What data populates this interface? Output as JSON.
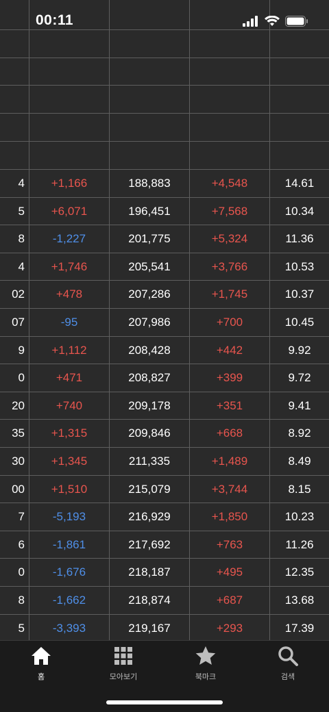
{
  "status_bar": {
    "time": "00:11"
  },
  "table": {
    "rows": [
      {
        "c0": "4",
        "c1": "+1,166",
        "c2": "188,883",
        "c3": "+4,548",
        "c4": "14.61",
        "s1": "pos",
        "s3": "pos"
      },
      {
        "c0": "5",
        "c1": "+6,071",
        "c2": "196,451",
        "c3": "+7,568",
        "c4": "10.34",
        "s1": "pos",
        "s3": "pos"
      },
      {
        "c0": "8",
        "c1": "-1,227",
        "c2": "201,775",
        "c3": "+5,324",
        "c4": "11.36",
        "s1": "neg",
        "s3": "pos"
      },
      {
        "c0": "4",
        "c1": "+1,746",
        "c2": "205,541",
        "c3": "+3,766",
        "c4": "10.53",
        "s1": "pos",
        "s3": "pos"
      },
      {
        "c0": "02",
        "c1": "+478",
        "c2": "207,286",
        "c3": "+1,745",
        "c4": "10.37",
        "s1": "pos",
        "s3": "pos"
      },
      {
        "c0": "07",
        "c1": "-95",
        "c2": "207,986",
        "c3": "+700",
        "c4": "10.45",
        "s1": "neg",
        "s3": "pos"
      },
      {
        "c0": "9",
        "c1": "+1,112",
        "c2": "208,428",
        "c3": "+442",
        "c4": "9.92",
        "s1": "pos",
        "s3": "pos"
      },
      {
        "c0": "0",
        "c1": "+471",
        "c2": "208,827",
        "c3": "+399",
        "c4": "9.72",
        "s1": "pos",
        "s3": "pos"
      },
      {
        "c0": "20",
        "c1": "+740",
        "c2": "209,178",
        "c3": "+351",
        "c4": "9.41",
        "s1": "pos",
        "s3": "pos"
      },
      {
        "c0": "35",
        "c1": "+1,315",
        "c2": "209,846",
        "c3": "+668",
        "c4": "8.92",
        "s1": "pos",
        "s3": "pos"
      },
      {
        "c0": "30",
        "c1": "+1,345",
        "c2": "211,335",
        "c3": "+1,489",
        "c4": "8.49",
        "s1": "pos",
        "s3": "pos"
      },
      {
        "c0": "00",
        "c1": "+1,510",
        "c2": "215,079",
        "c3": "+3,744",
        "c4": "8.15",
        "s1": "pos",
        "s3": "pos"
      },
      {
        "c0": "7",
        "c1": "-5,193",
        "c2": "216,929",
        "c3": "+1,850",
        "c4": "10.23",
        "s1": "neg",
        "s3": "pos"
      },
      {
        "c0": "6",
        "c1": "-1,861",
        "c2": "217,692",
        "c3": "+763",
        "c4": "11.26",
        "s1": "neg",
        "s3": "pos"
      },
      {
        "c0": "0",
        "c1": "-1,676",
        "c2": "218,187",
        "c3": "+495",
        "c4": "12.35",
        "s1": "neg",
        "s3": "pos"
      },
      {
        "c0": "8",
        "c1": "-1,662",
        "c2": "218,874",
        "c3": "+687",
        "c4": "13.68",
        "s1": "neg",
        "s3": "pos"
      },
      {
        "c0": "5",
        "c1": "-3,393",
        "c2": "219,167",
        "c3": "+293",
        "c4": "17.39",
        "s1": "neg",
        "s3": "pos"
      }
    ]
  },
  "colors": {
    "positive": "#e8554e",
    "negative": "#4f8fe8",
    "background": "#2a2a2a"
  },
  "tabbar": {
    "tabs": [
      {
        "label": "홈",
        "icon": "home-icon",
        "active": true
      },
      {
        "label": "모아보기",
        "icon": "grid-icon",
        "active": false
      },
      {
        "label": "북마크",
        "icon": "star-icon",
        "active": false
      },
      {
        "label": "검색",
        "icon": "search-icon",
        "active": false
      }
    ]
  }
}
